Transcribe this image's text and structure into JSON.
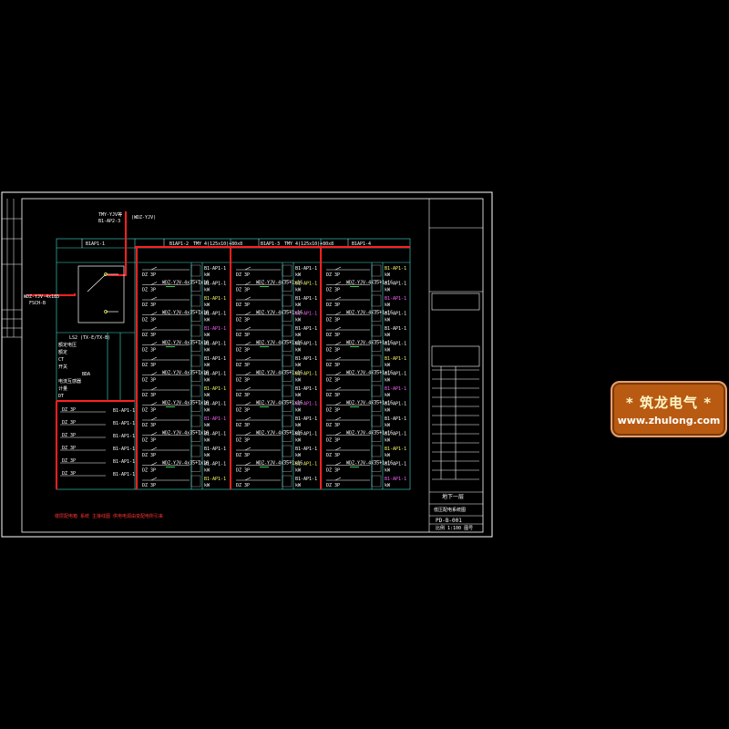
{
  "drawing": {
    "colors": {
      "background": "#000000",
      "frame": "#ffffff",
      "busbar": "#ff2020",
      "grid": "#40e0d0",
      "text": "#ffffff",
      "label_yellow": "#ffff66",
      "label_magenta": "#ff66ff",
      "tap_green": "#44ff66"
    },
    "incoming": {
      "label_1": "TMY-YJV等",
      "label_2": "B1-AP2-3",
      "label_3": "(WDZ-YJV)",
      "label_left": "WDZ-YJV-4x185",
      "label_left_2": "FSCH-B"
    },
    "panels": [
      {
        "tag": "B1AP1-1",
        "caption": ""
      },
      {
        "tag": "B1AP1-2",
        "caption": "TMY 4(125x10)+80x8"
      },
      {
        "tag": "B1AP1-3",
        "caption": "TMY 4(125x10)+80x8"
      },
      {
        "tag": "B1AP1-4",
        "caption": ""
      }
    ],
    "incomer_table": {
      "header": "LS2 (TX-E/TX-B)",
      "rows": [
        "额定电压",
        "额定",
        "CT",
        "开关",
        "BDA",
        "电流互感器",
        "计量",
        "DT"
      ]
    },
    "breaker_labels": {
      "rating": "DZ 3P",
      "cable": "WDZ-YJV-4x35+1x16",
      "circuit": "B1-AP1-1",
      "load": "kW"
    },
    "bottom_note": "楼层配电箱 系统 主接线图 供电电源由变配电所引来",
    "title_block": {
      "project": "地下一层",
      "drawing_title": "低压配电系统图",
      "drawing_no": "PD-B-001",
      "footer": "比例 1:100 图号"
    },
    "watermark": {
      "title": "* 筑龙电气 *",
      "url": "www.zhulong.com"
    }
  }
}
